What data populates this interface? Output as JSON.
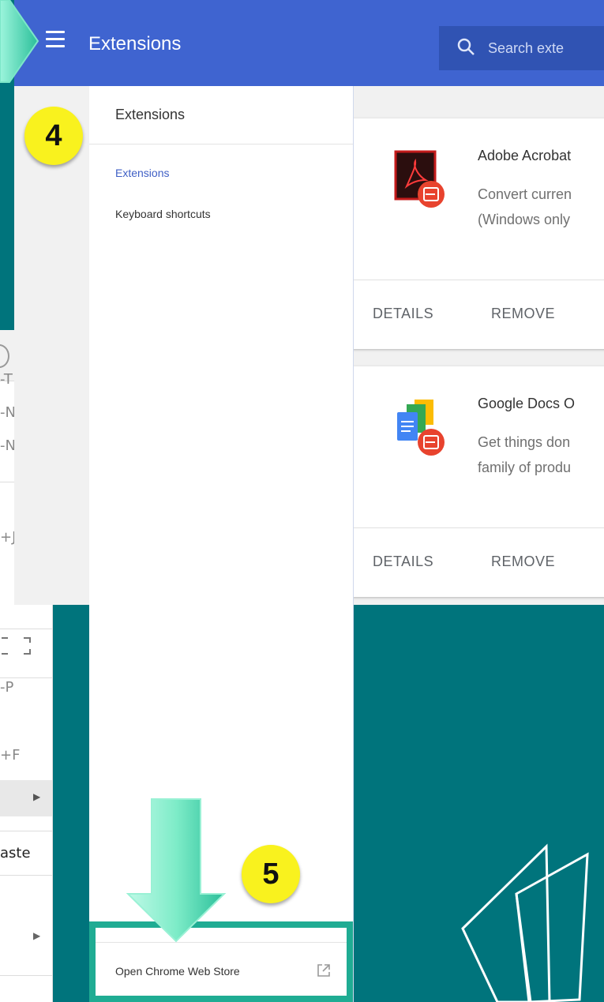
{
  "header": {
    "title": "Extensions",
    "search_placeholder": "Search exte"
  },
  "drawer": {
    "title": "Extensions",
    "nav": [
      {
        "label": "Extensions",
        "color": "#3f5fc5"
      },
      {
        "label": "Keyboard shortcuts",
        "color": "#333333"
      }
    ],
    "store_link": "Open Chrome Web Store"
  },
  "extensions": [
    {
      "name": "Adobe Acrobat",
      "desc_line1": "Convert curren",
      "desc_line2": "(Windows only",
      "details_label": "DETAILS",
      "remove_label": "REMOVE"
    },
    {
      "name": "Google Docs O",
      "desc_line1": "Get things don",
      "desc_line2": "family of produ",
      "details_label": "DETAILS",
      "remove_label": "REMOVE"
    }
  ],
  "chrome_menu": {
    "items": [
      {
        "text": "-T",
        "arrow": false
      },
      {
        "text": "-N",
        "arrow": false
      },
      {
        "text": "-N",
        "arrow": false
      },
      {
        "text": "",
        "arrow": true
      },
      {
        "text": "+J",
        "arrow": false
      },
      {
        "text": "",
        "arrow": true
      },
      {
        "text": "-P",
        "arrow": false
      },
      {
        "text": "+F",
        "arrow": false
      },
      {
        "text": "",
        "arrow": true
      },
      {
        "text": "aste",
        "arrow": false
      },
      {
        "text": "",
        "arrow": true
      }
    ]
  },
  "annotations": {
    "step4": "4",
    "step5": "5"
  },
  "colors": {
    "background": "#00747c",
    "header": "#3f64d0",
    "highlight": "#1fac93",
    "badge": "#f9f21e",
    "accent_arrow": "#6fe4c4"
  }
}
